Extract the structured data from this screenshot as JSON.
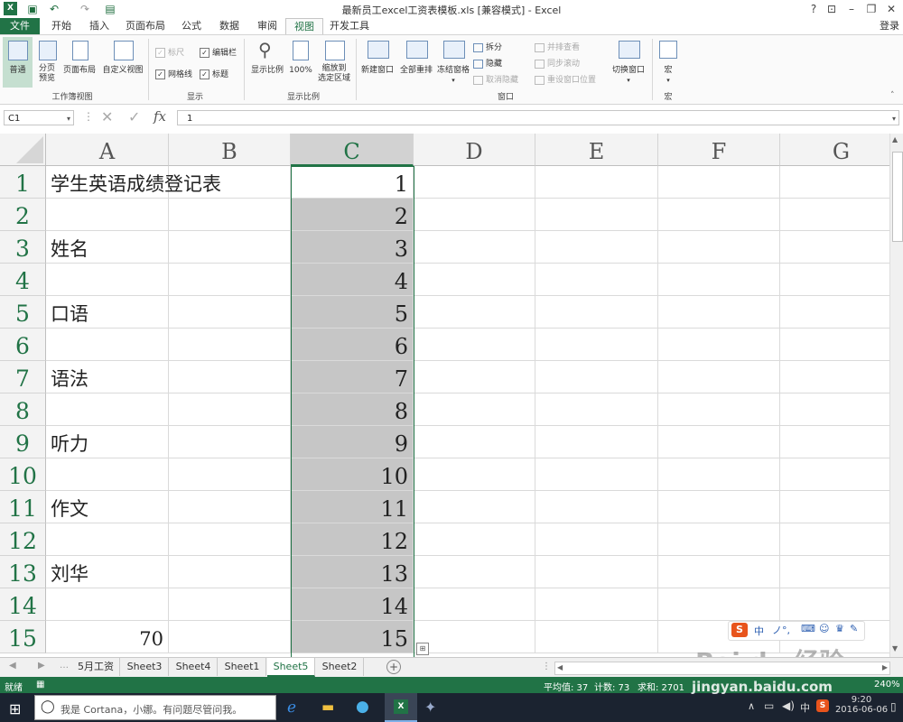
{
  "title": "最新员工excel工资表模板.xls  [兼容模式] - Excel",
  "login": "登录",
  "tabs": [
    "文件",
    "开始",
    "插入",
    "页面布局",
    "公式",
    "数据",
    "审阅",
    "视图",
    "开发工具"
  ],
  "ribbon": {
    "normal": "普通",
    "page_break": "分页\n预览",
    "page_layout": "页面布局",
    "custom_view": "自定义视图",
    "grp_workbook_view": "工作簿视图",
    "ruler": "标尺",
    "formula_bar": "编辑栏",
    "gridlines": "网格线",
    "headings": "标题",
    "grp_show": "显示",
    "zoom": "显示比例",
    "zoom100": "100%",
    "zoom_sel": "缩放到\n选定区域",
    "grp_zoom": "显示比例",
    "new_window": "新建窗口",
    "arrange_all": "全部重排",
    "freeze": "冻结窗格",
    "split": "拆分",
    "hide": "隐藏",
    "unhide": "取消隐藏",
    "side_by_side": "并排查看",
    "sync_scroll": "同步滚动",
    "reset_pos": "重设窗口位置",
    "grp_window": "窗口",
    "switch": "切换窗口",
    "macro": "宏",
    "grp_macro": "宏"
  },
  "name_box": "C1",
  "formula_value": "1",
  "columns": [
    "A",
    "B",
    "C",
    "D",
    "E",
    "F",
    "G"
  ],
  "rows": [
    {
      "n": "1",
      "a": "学生英语成绩登记表",
      "c": "1"
    },
    {
      "n": "2",
      "a": "",
      "c": "2"
    },
    {
      "n": "3",
      "a": "姓名",
      "c": "3"
    },
    {
      "n": "4",
      "a": "",
      "c": "4"
    },
    {
      "n": "5",
      "a": "口语",
      "c": "5"
    },
    {
      "n": "6",
      "a": "",
      "c": "6"
    },
    {
      "n": "7",
      "a": "语法",
      "c": "7"
    },
    {
      "n": "8",
      "a": "",
      "c": "8"
    },
    {
      "n": "9",
      "a": "听力",
      "c": "9"
    },
    {
      "n": "10",
      "a": "",
      "c": "10"
    },
    {
      "n": "11",
      "a": "作文",
      "c": "11"
    },
    {
      "n": "12",
      "a": "",
      "c": "12"
    },
    {
      "n": "13",
      "a": "刘华",
      "c": "13"
    },
    {
      "n": "14",
      "a": "",
      "c": "14"
    },
    {
      "n": "15",
      "a": "70",
      "c": "15"
    }
  ],
  "sheets": [
    "5月工资",
    "Sheet3",
    "Sheet4",
    "Sheet1",
    "Sheet5",
    "Sheet2"
  ],
  "active_sheet": "Sheet5",
  "status": {
    "ready": "就绪",
    "average": "平均值: 37",
    "count": "计数: 73",
    "sum": "求和: 2701",
    "zoom": "240%"
  },
  "taskbar": {
    "cortana": "我是 Cortana，小娜。有问题尽管问我。",
    "ime": "中",
    "time": "9:20",
    "date": "2016-06-06"
  },
  "watermark": "Bai du 经验",
  "watermark_url": "jingyan.baidu.com",
  "accent": "#217346"
}
